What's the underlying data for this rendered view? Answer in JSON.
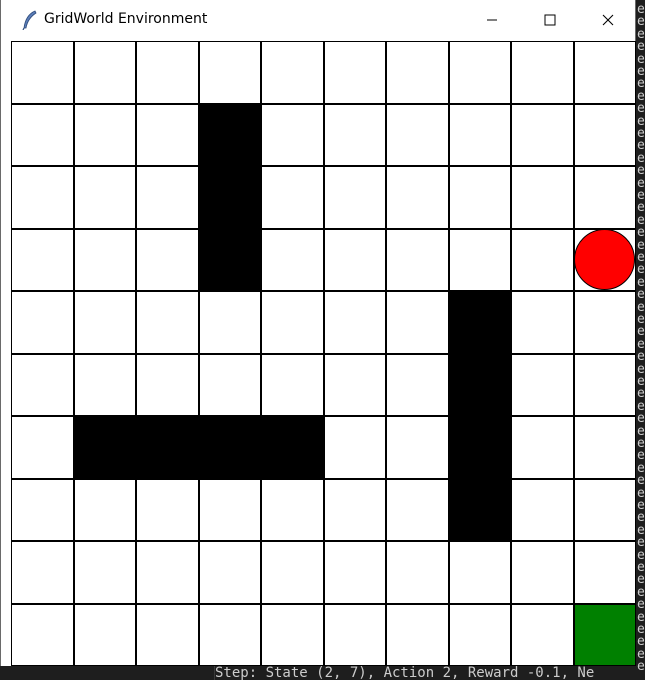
{
  "window": {
    "title": "GridWorld Environment",
    "controls": [
      "minimize",
      "maximize",
      "close"
    ]
  },
  "grid": {
    "rows": 10,
    "cols": 10,
    "cell_color": "#ffffff",
    "line_color": "#000000",
    "wall_color": "#000000",
    "walls": [
      [
        1,
        3
      ],
      [
        2,
        3
      ],
      [
        3,
        3
      ],
      [
        4,
        7
      ],
      [
        5,
        7
      ],
      [
        6,
        7
      ],
      [
        7,
        7
      ],
      [
        6,
        1
      ],
      [
        6,
        2
      ],
      [
        6,
        3
      ],
      [
        6,
        4
      ]
    ],
    "goal": {
      "row": 9,
      "col": 9,
      "color": "#008000"
    },
    "agent": {
      "row": 3,
      "col": 9,
      "color": "#ff0000",
      "shape": "circle"
    }
  },
  "background_terminal": {
    "left_fragments": [
      "r",
      "r"
    ],
    "bottom_text": "Step: State (2, 7), Action 2, Reward -0.1, Ne"
  }
}
